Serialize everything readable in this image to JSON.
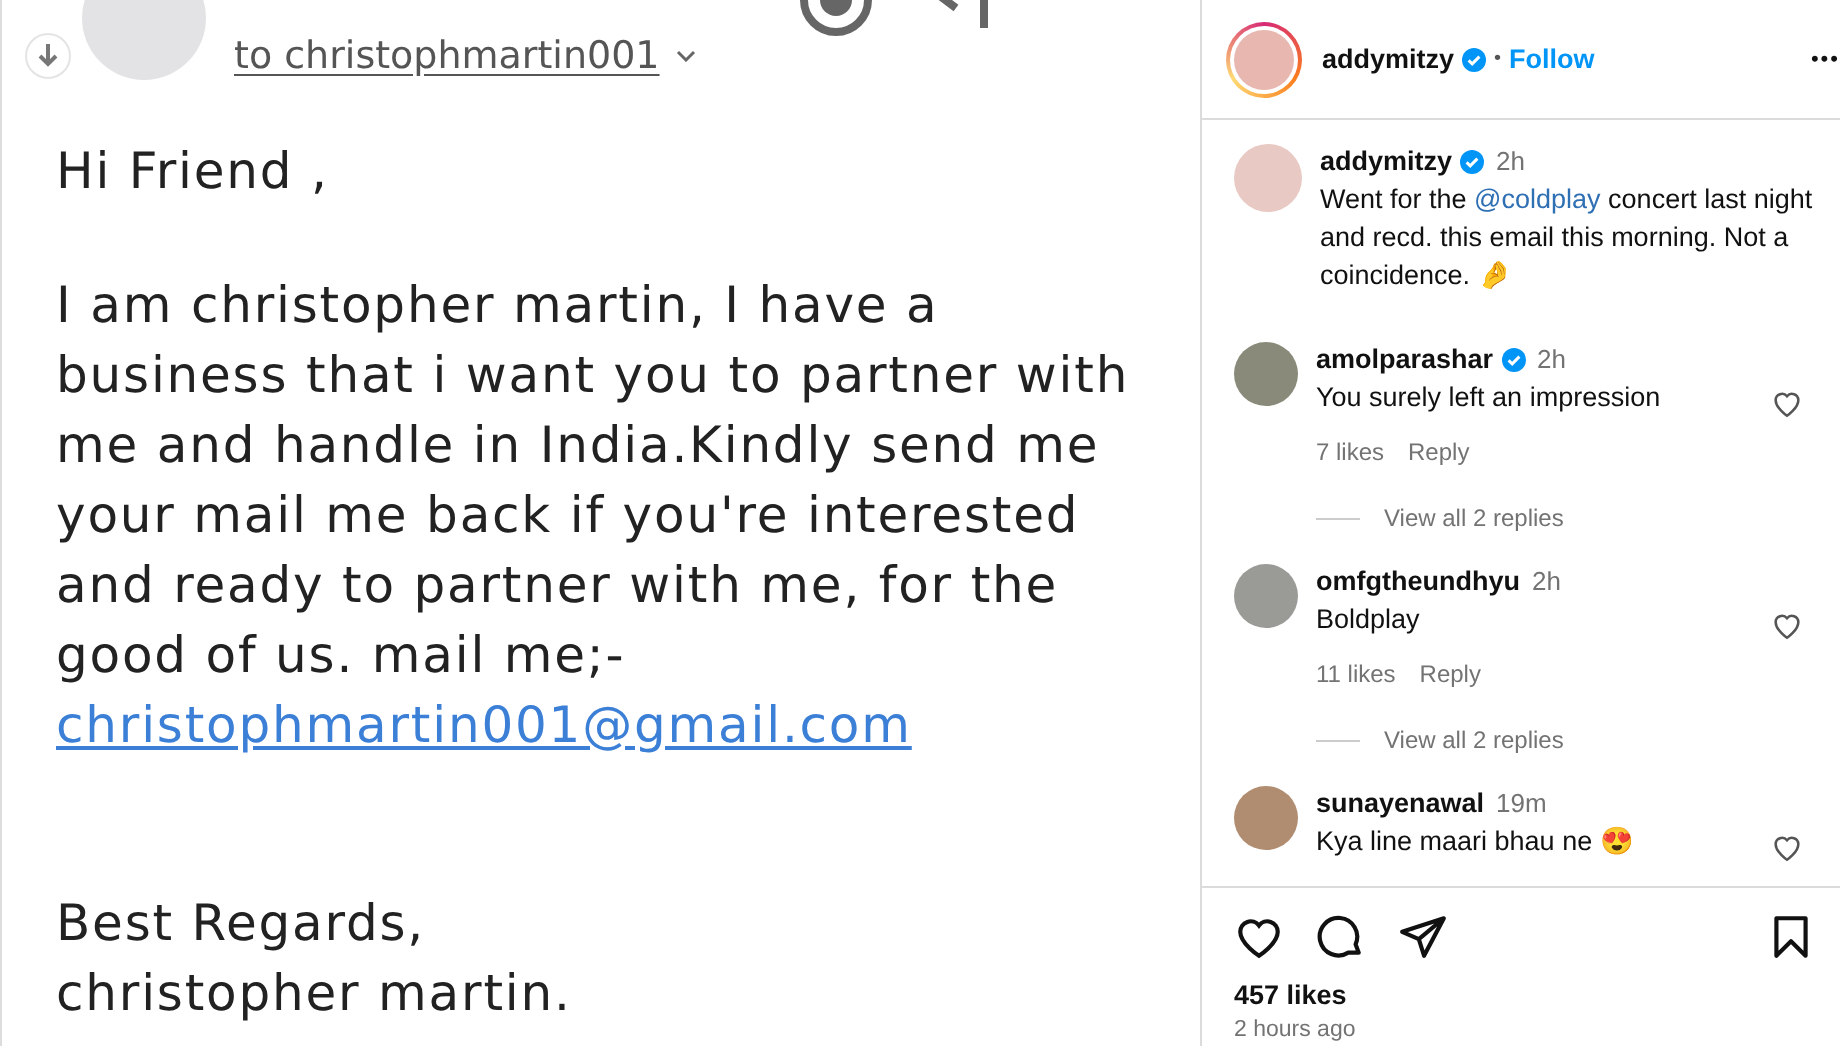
{
  "email": {
    "recipient": "to christophmartin001",
    "greeting": "Hi Friend ,",
    "body": "I am christopher martin, I have a business that i want you to partner with me and handle in India.Kindly send me your mail me back if you're interested and ready to partner with me, for the good of us. mail me;-",
    "email_link": "christophmartin001@gmail.com",
    "closing": "Best Regards,",
    "signature": "christopher martin."
  },
  "post": {
    "header": {
      "username": "addymitzy",
      "verified": true,
      "separator": "•",
      "follow": "Follow",
      "more": "•••"
    },
    "caption": {
      "username": "addymitzy",
      "verified": true,
      "time": "2h",
      "text_before": "Went for the ",
      "mention": "@coldplay",
      "text_after": " concert last night and recd. this email this morning. Not a coincidence. 🤌"
    },
    "comments": [
      {
        "username": "amolparashar",
        "verified": true,
        "time": "2h",
        "text": "You surely left an impression",
        "likes": "7 likes",
        "reply": "Reply",
        "view_replies": "View all 2 replies"
      },
      {
        "username": "omfgtheundhyu",
        "verified": false,
        "time": "2h",
        "text": "Boldplay",
        "likes": "11 likes",
        "reply": "Reply",
        "view_replies": "View all 2 replies"
      },
      {
        "username": "sunayenawal",
        "verified": false,
        "time": "19m",
        "text": "Kya line maari bhau ne 😍"
      }
    ],
    "likes": "457 likes",
    "posted": "2 hours ago"
  }
}
